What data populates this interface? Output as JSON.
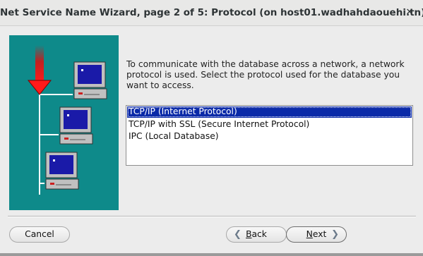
{
  "window": {
    "title": "Net Service Name Wizard, page 2 of 5: Protocol (on host01.wadhahdaouehi.tn)",
    "close_label": "✕"
  },
  "main": {
    "description": "To communicate with the database across a network, a network protocol is used.  Select the protocol used for the database you want to access."
  },
  "protocol_list": {
    "items": [
      "TCP/IP (Internet Protocol)",
      "TCP/IP with SSL (Secure Internet Protocol)",
      "IPC (Local Database)"
    ],
    "selected_index": 0
  },
  "buttons": {
    "cancel": "Cancel",
    "back_mnemonic": "B",
    "back_rest": "ack",
    "next_mnemonic": "N",
    "next_rest": "ext",
    "back_chevron": "❮",
    "next_chevron": "❯"
  },
  "colors": {
    "illustration_bg": "#0e8a8a",
    "selection_bg": "#0a2aa8",
    "arrow_red": "#e01818"
  },
  "icons": [
    "network-computer-icon",
    "down-arrow-icon",
    "close-icon"
  ]
}
